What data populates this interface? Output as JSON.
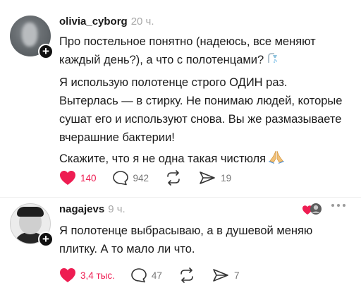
{
  "comments": [
    {
      "username": "olivia_cyborg",
      "time": "20 ч.",
      "lines": [
        "Про постельное понятно (надеюсь, все меняют каждый день?), а что с полотенцами?",
        "Я использую полотенце строго ОДИН раз. Вытерлась — в стирку. Не понимаю людей, которые сушат его и используют снова. Вы же размазываете вчерашние бактерии!",
        "Скажите, что я не одна такая чистюля"
      ],
      "emojis": [
        "shower-emoji",
        "praying-hands-emoji"
      ],
      "likes": "140",
      "replies": "942",
      "shares": "19",
      "liked": true
    },
    {
      "username": "nagajevs",
      "time": "9 ч.",
      "lines": [
        "Я полотенце выбрасываю, а в душевой меняю плитку. А то мало ли что."
      ],
      "likes": "3,4 тыс.",
      "replies": "47",
      "shares": "7",
      "liked": true,
      "author_liked": true
    }
  ],
  "colors": {
    "like": "#ee1d52",
    "muted": "#a8a8a8",
    "text": "#1b1b1b"
  },
  "icons": [
    "plus-icon",
    "heart-icon",
    "comment-icon",
    "repost-icon",
    "share-icon",
    "more-icon"
  ]
}
